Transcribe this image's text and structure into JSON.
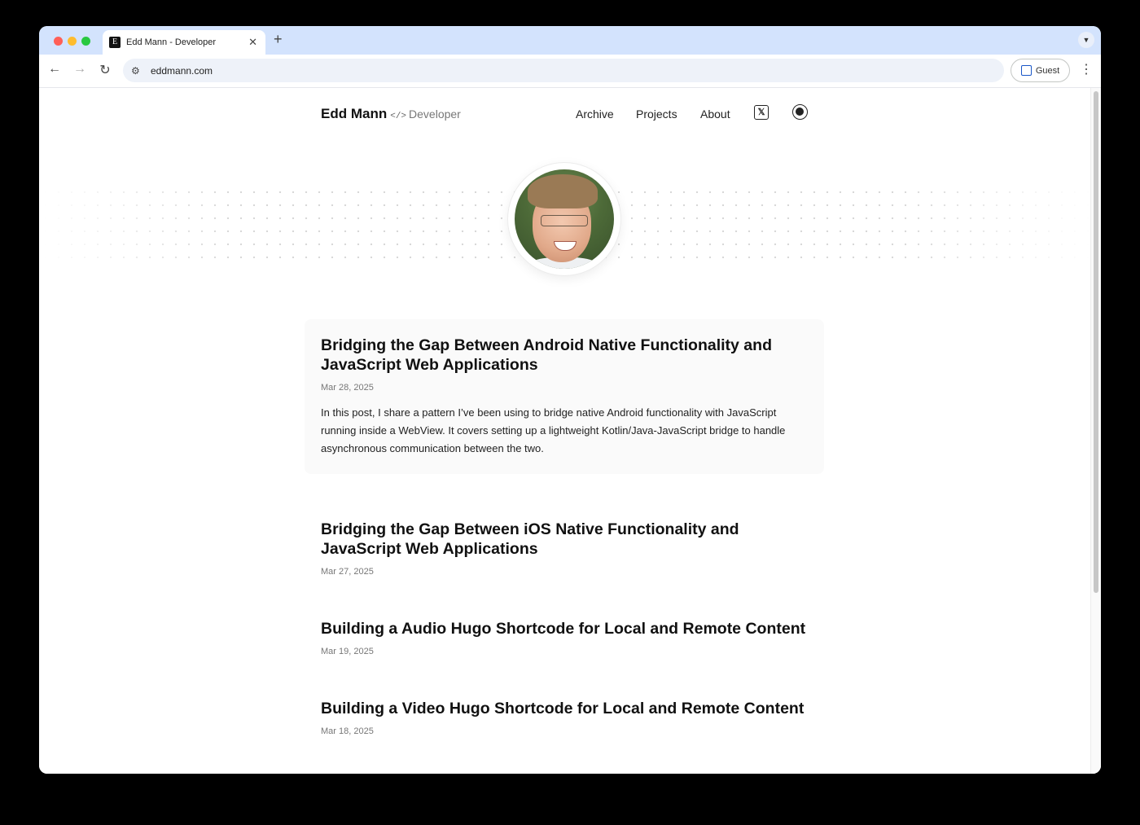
{
  "browser": {
    "tab_title": "Edd Mann - Developer",
    "tab_favicon": "E",
    "url": "eddmann.com",
    "profile_label": "Guest"
  },
  "site": {
    "brand_name": "Edd Mann",
    "brand_code": "</>",
    "brand_tagline": "Developer",
    "nav": [
      {
        "label": "Archive"
      },
      {
        "label": "Projects"
      },
      {
        "label": "About"
      }
    ],
    "social": [
      {
        "icon": "x-twitter-icon"
      },
      {
        "icon": "github-icon"
      }
    ]
  },
  "posts": [
    {
      "title": "Bridging the Gap Between Android Native Functionality and JavaScript Web Applications",
      "date": "Mar 28, 2025",
      "excerpt": "In this post, I share a pattern I’ve been using to bridge native Android functionality with JavaScript running inside a WebView. It covers setting up a lightweight Kotlin/Java-JavaScript bridge to handle asynchronous communication between the two."
    },
    {
      "title": "Bridging the Gap Between iOS Native Functionality and JavaScript Web Applications",
      "date": "Mar 27, 2025"
    },
    {
      "title": "Building a Audio Hugo Shortcode for Local and Remote Content",
      "date": "Mar 19, 2025"
    },
    {
      "title": "Building a Video Hugo Shortcode for Local and Remote Content",
      "date": "Mar 18, 2025"
    }
  ]
}
